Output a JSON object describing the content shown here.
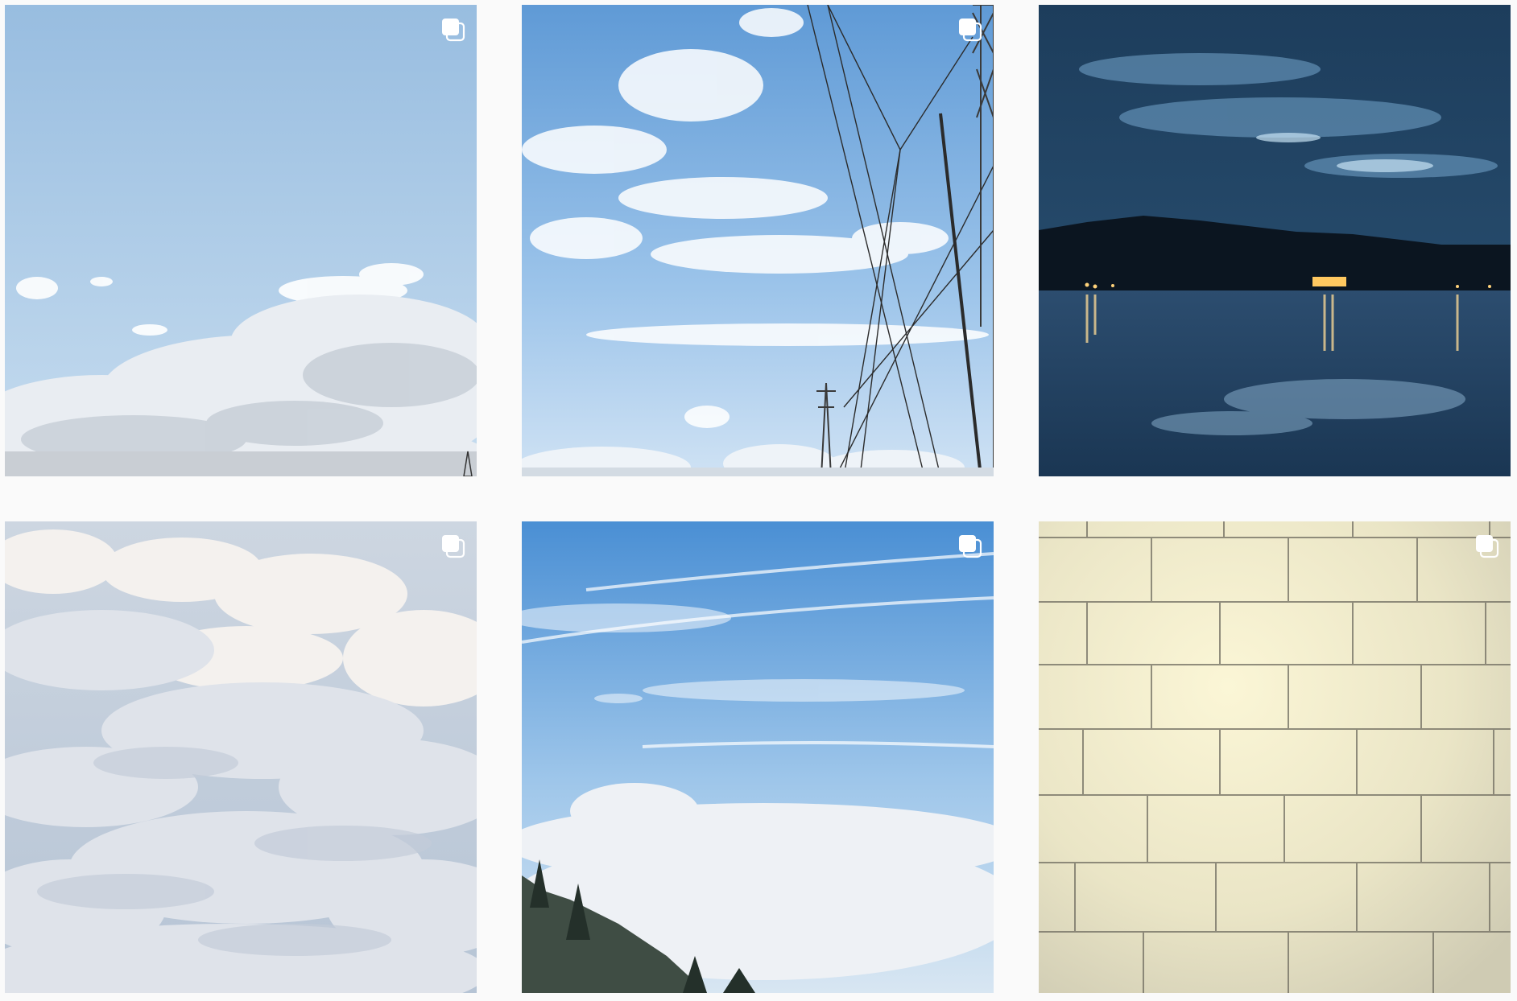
{
  "feed": {
    "posts": [
      {
        "photo": "blue-sky-cumulus-clouds",
        "overlay_icon": "multiple-photos-icon"
      },
      {
        "photo": "sky-with-power-lines",
        "overlay_icon": "multiple-photos-icon"
      },
      {
        "photo": "dusk-lake-reflection",
        "overlay_icon": ""
      },
      {
        "photo": "sea-of-clouds",
        "overlay_icon": "multiple-photos-icon"
      },
      {
        "photo": "clouds-below-mountain-ridge",
        "overlay_icon": "multiple-photos-icon"
      },
      {
        "photo": "subway-tile-wall",
        "overlay_icon": "multiple-photos-icon"
      }
    ]
  },
  "colors": {
    "page_background": "#fafafa",
    "icon": "#ffffff"
  }
}
